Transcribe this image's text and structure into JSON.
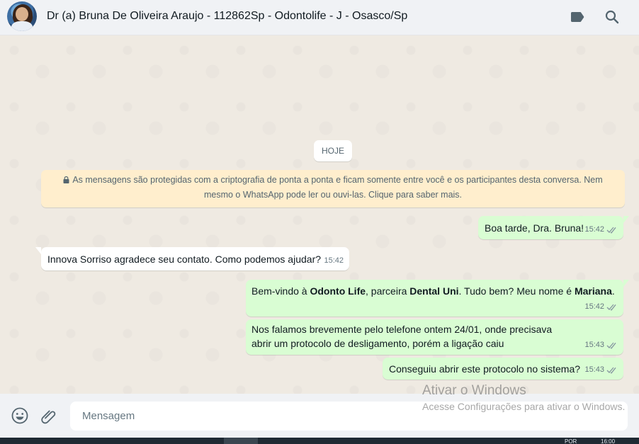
{
  "header": {
    "title": "Dr (a) Bruna De Oliveira Araujo - 112862Sp - Odontolife - J - Osasco/Sp",
    "icons": [
      "label-icon",
      "search-icon"
    ]
  },
  "chat": {
    "day_chip": "HOJE",
    "encryption_notice": "As mensagens são protegidas com a criptografia de ponta a ponta e ficam somente entre você e os participantes desta conversa. Nem mesmo o WhatsApp pode ler ou ouvi-las. Clique para saber mais.",
    "messages": [
      {
        "direction": "out",
        "text": "Boa tarde, Dra. Bruna!",
        "time": "15:42",
        "status": "read"
      },
      {
        "direction": "in",
        "text": "Innova Sorriso agradece seu contato. Como podemos ajudar?",
        "time": "15:42"
      },
      {
        "direction": "out",
        "parts": [
          "Bem-vindo à ",
          "Odonto Life",
          ", parceira ",
          "Dental Uni",
          ". Tudo bem? Meu nome é ",
          "Mariana",
          "."
        ],
        "time": "15:42",
        "status": "read"
      },
      {
        "direction": "out",
        "text": "Nos falamos brevemente pelo telefone ontem 24/01, onde precisava abrir um protocolo de desligamento, porém a ligação caiu",
        "time": "15:43",
        "status": "read"
      },
      {
        "direction": "out",
        "text": "Conseguiu abrir este protocolo no sistema?",
        "time": "15:43",
        "status": "read"
      }
    ]
  },
  "composer": {
    "placeholder": "Mensagem",
    "icons": [
      "emoji-icon",
      "attach-icon"
    ]
  },
  "watermark": {
    "line1": "Ativar o Windows",
    "line2": "Acesse Configurações para ativar o Windows."
  },
  "taskbar": {
    "lang": "POR",
    "clock": "16:00"
  },
  "colors": {
    "outgoing_bubble": "#d9fdd3",
    "incoming_bubble": "#ffffff",
    "chat_background": "#efeae2",
    "encryption_notice_bg": "#ffeecd",
    "read_ticks": "#8696a0"
  }
}
